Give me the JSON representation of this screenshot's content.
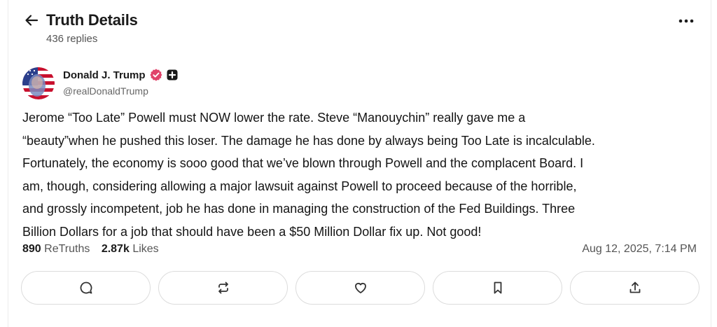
{
  "header": {
    "title": "Truth Details",
    "replies": "436 replies"
  },
  "author": {
    "name": "Donald J. Trump",
    "handle": "@realDonaldTrump"
  },
  "post": {
    "lines": [
      "Jerome “Too Late” Powell must NOW lower the rate. Steve “Manouychin” really gave me a",
      "“beauty”when he pushed this loser. The damage he has done by always being Too Late is incalculable.",
      "Fortunately, the economy is sooo good that we’ve blown through Powell and the complacent Board. I",
      "am, though, considering allowing a major lawsuit against Powell to proceed because of the horrible,",
      "and grossly incompetent, job he has done in managing the construction of the Fed Buildings. Three",
      "Billion Dollars for a job that should have been a $50 Million Dollar fix up. Not good!"
    ]
  },
  "stats": {
    "retruths_count": "890",
    "retruths_label": "ReTruths",
    "likes_count": "2.87k",
    "likes_label": "Likes",
    "timestamp": "Aug 12, 2025, 7:14 PM"
  },
  "icons": {
    "back": "arrow-left-icon",
    "more": "more-dots-icon",
    "verified": "verified-badge-icon",
    "plus": "plus-badge-icon",
    "reply": "reply-bubble-icon",
    "retruth": "retruth-icon",
    "like": "heart-icon",
    "bookmark": "bookmark-icon",
    "share": "share-icon"
  },
  "colors": {
    "verified": "#e0436a",
    "text": "#141414",
    "muted": "#555555",
    "border": "#dcdcdc"
  }
}
